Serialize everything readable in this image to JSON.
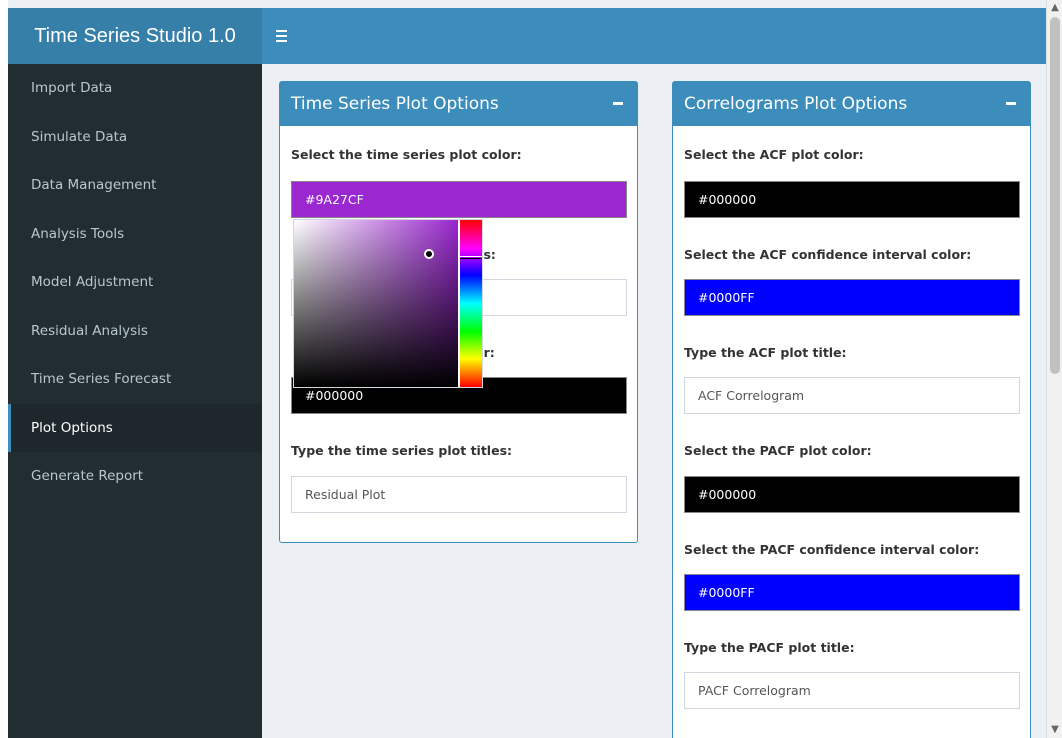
{
  "app": {
    "title": "Time Series Studio 1.0"
  },
  "sidebar": {
    "items": [
      {
        "label": "Import Data"
      },
      {
        "label": "Simulate Data"
      },
      {
        "label": "Data Management"
      },
      {
        "label": "Analysis Tools"
      },
      {
        "label": "Model Adjustment"
      },
      {
        "label": "Residual Analysis"
      },
      {
        "label": "Time Series Forecast"
      },
      {
        "label": "Plot Options",
        "active": true
      },
      {
        "label": "Generate Report"
      }
    ]
  },
  "ts_box": {
    "title": "Time Series Plot Options",
    "color_label": "Select the time series plot color:",
    "color_value": "#9A27CF",
    "hidden_label_fragment_1": "es:",
    "hidden_label_fragment_2": "or:",
    "hidden_color_value": "#000000",
    "titles_label": "Type the time series plot titles:",
    "titles_value": "Residual Plot"
  },
  "corr_box": {
    "title": "Correlograms Plot Options",
    "acf_color_label": "Select the ACF plot color:",
    "acf_color_value": "#000000",
    "acf_ci_label": "Select the ACF confidence interval color:",
    "acf_ci_value": "#0000FF",
    "acf_title_label": "Type the ACF plot title:",
    "acf_title_value": "ACF Correlogram",
    "pacf_color_label": "Select the PACF plot color:",
    "pacf_color_value": "#000000",
    "pacf_ci_label": "Select the PACF confidence interval color:",
    "pacf_ci_value": "#0000FF",
    "pacf_title_label": "Type the PACF plot title:",
    "pacf_title_value": "PACF Correlogram"
  },
  "colors": {
    "header": "#3c8dbc",
    "logo": "#367fa9",
    "sidebar": "#222d32",
    "selected_plot": "#9A27CF",
    "ci": "#0000FF"
  },
  "icons": {
    "menu": "hamburger-icon",
    "collapse": "minus-icon",
    "scroll_up": "chevron-up-icon",
    "scroll_down": "chevron-down-icon"
  }
}
